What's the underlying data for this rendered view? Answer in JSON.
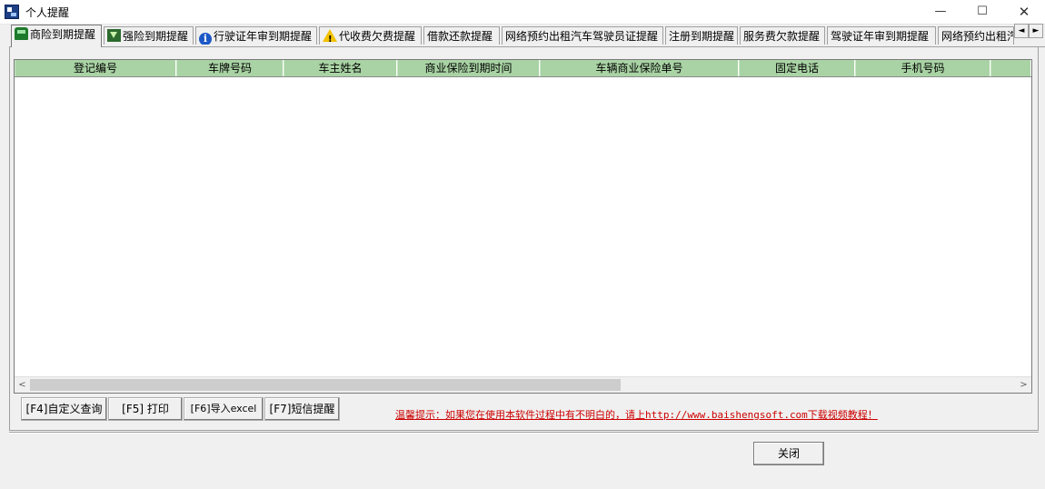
{
  "window": {
    "title": "个人提醒",
    "min": "—",
    "max": "☐",
    "close": "✕"
  },
  "tabs": [
    {
      "label": "商险到期提醒",
      "icon": "car-icon",
      "active": true
    },
    {
      "label": "强险到期提醒",
      "icon": "down-arrow-icon"
    },
    {
      "label": "行驶证年审到期提醒",
      "icon": "info-icon"
    },
    {
      "label": "代收费欠费提醒",
      "icon": "warning-icon"
    },
    {
      "label": "借款还款提醒"
    },
    {
      "label": "网络预约出租汽车驾驶员证提醒"
    },
    {
      "label": "注册到期提醒"
    },
    {
      "label": "服务费欠款提醒"
    },
    {
      "label": "驾驶证年审到期提醒"
    },
    {
      "label": "网络预约出租汽"
    }
  ],
  "tab_scroll": {
    "left": "◄",
    "right": "►"
  },
  "grid": {
    "columns": [
      "登记编号",
      "车牌号码",
      "车主姓名",
      "商业保险到期时间",
      "车辆商业保险单号",
      "固定电话",
      "手机号码",
      ""
    ],
    "rows": [],
    "scroll_left": "<",
    "scroll_right": ">"
  },
  "buttons": {
    "custom_query": "[F4]自定义查询",
    "print": "[F5] 打印",
    "export_excel": "[F6]导入excel",
    "sms_reminder": "[F7]短信提醒"
  },
  "hint": "温馨提示：如果您在使用本软件过程中有不明白的，请上http://www.baishengsoft.com下载视频教程！",
  "close_label": "关闭",
  "colors": {
    "header_bg": "#a9d3a4",
    "hint": "#cc0000"
  }
}
